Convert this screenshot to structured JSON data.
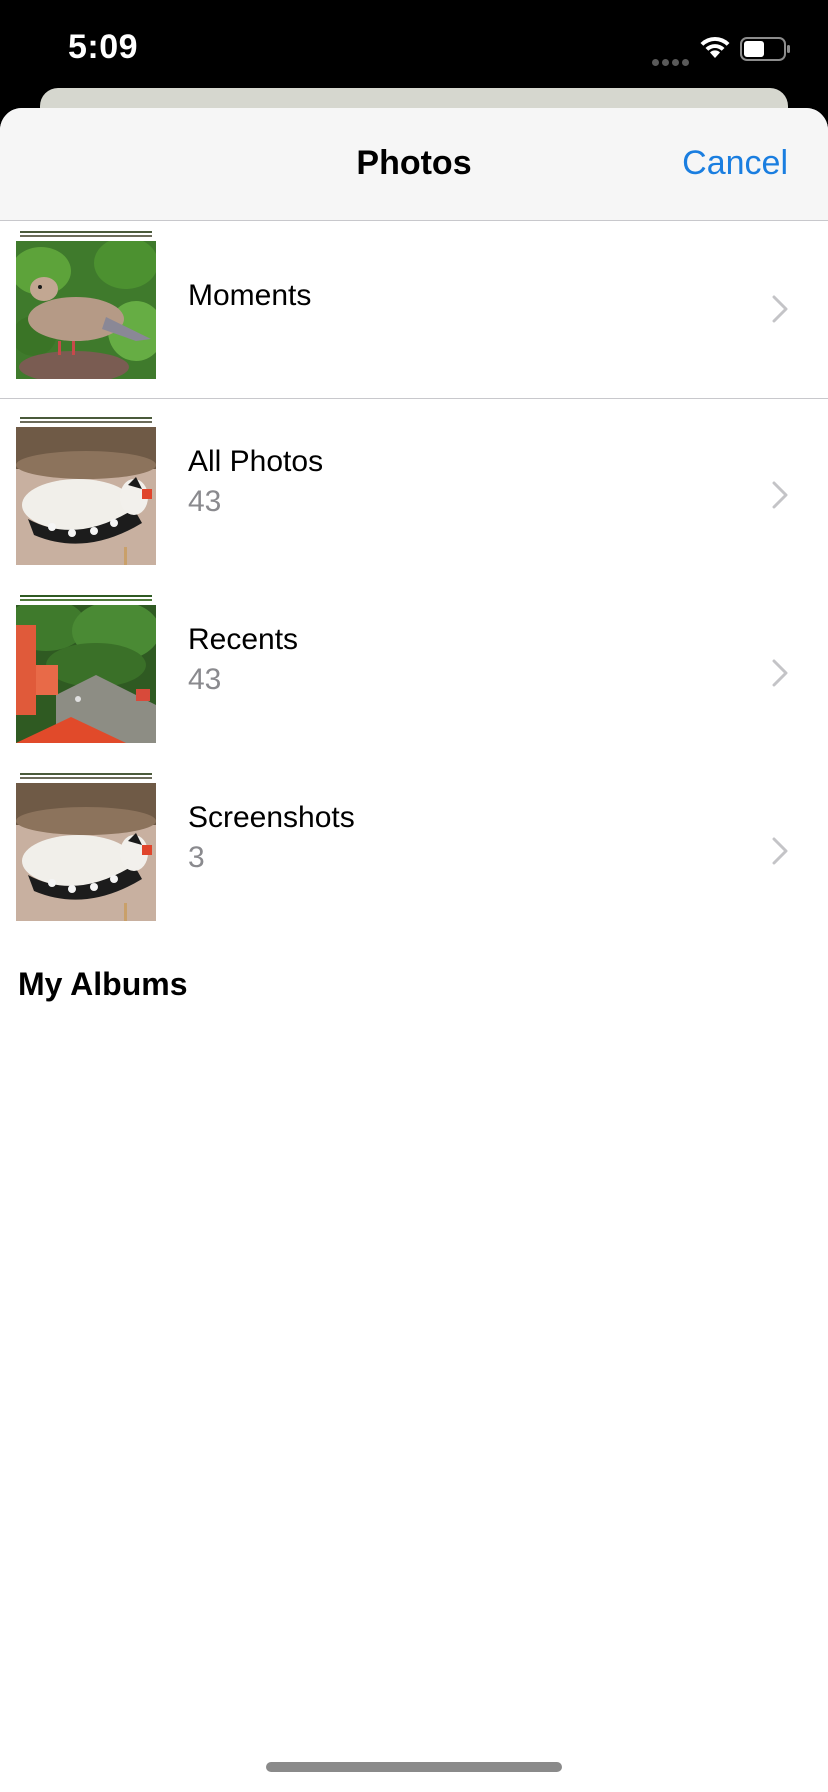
{
  "status_bar": {
    "time": "5:09"
  },
  "nav": {
    "title": "Photos",
    "cancel_label": "Cancel"
  },
  "albums": [
    {
      "name": "Moments",
      "count": "",
      "icon": "dove-photo-thumbnail"
    },
    {
      "name": "All Photos",
      "count": "43",
      "icon": "woodpecker-photo-thumbnail"
    },
    {
      "name": "Recents",
      "count": "43",
      "icon": "garden-photo-thumbnail"
    },
    {
      "name": "Screenshots",
      "count": "3",
      "icon": "woodpecker-photo-thumbnail"
    }
  ],
  "sections": {
    "my_albums": "My Albums"
  },
  "colors": {
    "accent": "#1a7ee0",
    "secondary_text": "#8a8a8e",
    "nav_background": "#f6f6f6"
  }
}
